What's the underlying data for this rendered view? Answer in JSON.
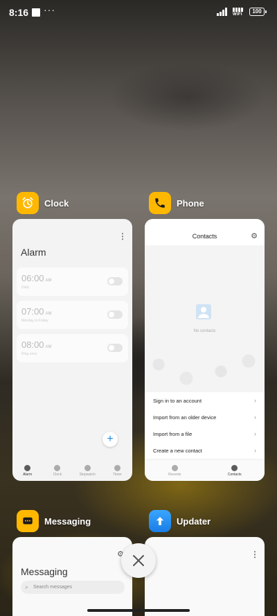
{
  "status_bar": {
    "time": "8:16",
    "dots": "···",
    "wifi_label": "WIFI",
    "battery": "100"
  },
  "recents": [
    {
      "app_name": "Clock",
      "icon": "alarm-clock-icon",
      "alarm_title": "Alarm",
      "alarms": [
        {
          "time": "06:00",
          "ampm": "AM",
          "subtitle": "Daily"
        },
        {
          "time": "07:00",
          "ampm": "AM",
          "subtitle": "Monday to Friday"
        },
        {
          "time": "08:00",
          "ampm": "AM",
          "subtitle": "Ring once"
        }
      ],
      "fab_label": "+",
      "nav": [
        "Alarm",
        "Clock",
        "Stopwatch",
        "Timer"
      ]
    },
    {
      "app_name": "Phone",
      "icon": "phone-icon",
      "title": "Contacts",
      "empty_text": "No contacts",
      "options": [
        "Sign in to an account",
        "Import from an older device",
        "Import from a file",
        "Create a new contact"
      ],
      "nav": [
        "Recents",
        "Contacts"
      ]
    },
    {
      "app_name": "Messaging",
      "icon": "chat-icon",
      "title": "Messaging",
      "search_placeholder": "Search messages"
    },
    {
      "app_name": "Updater",
      "icon": "arrow-up-icon"
    }
  ],
  "colors": {
    "accent_yellow": "#ffb800",
    "updater_blue": "#1a7de6",
    "fab_blue": "#1e8ae6"
  }
}
